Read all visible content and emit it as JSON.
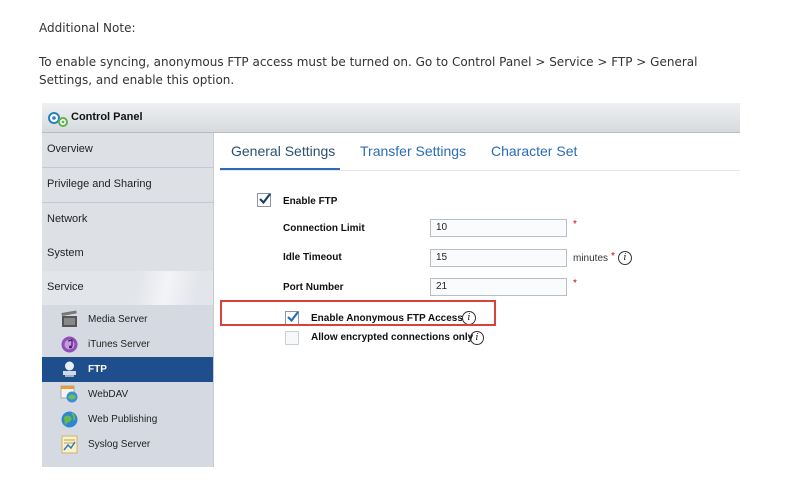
{
  "doc": {
    "note_heading": "Additional Note:",
    "paragraph": "To enable syncing, anonymous FTP access must be turned on. Go to Control Panel > Service > FTP > General Settings, and enable this option."
  },
  "window": {
    "title": "Control Panel"
  },
  "sidebar": {
    "items": [
      {
        "label": "Overview"
      },
      {
        "label": "Privilege and Sharing"
      },
      {
        "label": "Network"
      },
      {
        "label": "System"
      },
      {
        "label": "Service"
      }
    ],
    "service_items": [
      {
        "label": "Media Server",
        "icon": "media-server-icon"
      },
      {
        "label": "iTunes Server",
        "icon": "itunes-icon"
      },
      {
        "label": "FTP",
        "icon": "ftp-icon",
        "active": true
      },
      {
        "label": "WebDAV",
        "icon": "webdav-icon"
      },
      {
        "label": "Web Publishing",
        "icon": "web-publishing-icon"
      },
      {
        "label": "Syslog Server",
        "icon": "syslog-icon"
      }
    ]
  },
  "tabs": [
    {
      "label": "General Settings",
      "active": true
    },
    {
      "label": "Transfer Settings"
    },
    {
      "label": "Character Set"
    }
  ],
  "form": {
    "enable_ftp": {
      "label": "Enable FTP",
      "checked": true
    },
    "connection_limit": {
      "label": "Connection Limit",
      "value": "10",
      "required": "*"
    },
    "idle_timeout": {
      "label": "Idle Timeout",
      "value": "15",
      "unit": "minutes",
      "required": "*"
    },
    "port_number": {
      "label": "Port Number",
      "value": "21",
      "required": "*"
    },
    "enable_anonymous": {
      "label": "Enable Anonymous FTP Access",
      "checked": true
    },
    "encrypted_only": {
      "label": "Allow encrypted connections only",
      "checked": false
    },
    "info_glyph": "i"
  },
  "colors": {
    "accent": "#2a6db5",
    "active_nav": "#1e4f8c",
    "highlight_border": "#d9413b",
    "required": "#d10000"
  }
}
